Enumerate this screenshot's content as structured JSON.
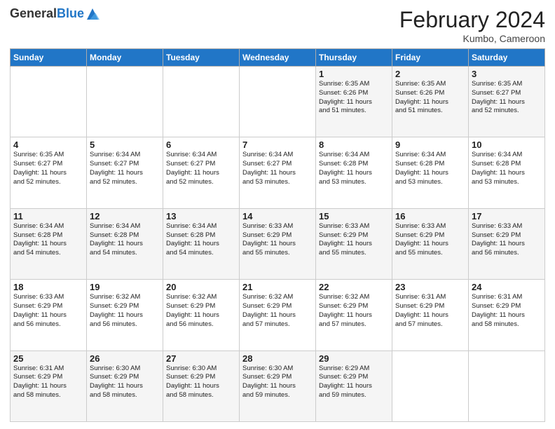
{
  "header": {
    "logo_general": "General",
    "logo_blue": "Blue",
    "month_title": "February 2024",
    "location": "Kumbo, Cameroon"
  },
  "weekdays": [
    "Sunday",
    "Monday",
    "Tuesday",
    "Wednesday",
    "Thursday",
    "Friday",
    "Saturday"
  ],
  "weeks": [
    [
      {
        "day": "",
        "info": ""
      },
      {
        "day": "",
        "info": ""
      },
      {
        "day": "",
        "info": ""
      },
      {
        "day": "",
        "info": ""
      },
      {
        "day": "1",
        "info": "Sunrise: 6:35 AM\nSunset: 6:26 PM\nDaylight: 11 hours\nand 51 minutes."
      },
      {
        "day": "2",
        "info": "Sunrise: 6:35 AM\nSunset: 6:26 PM\nDaylight: 11 hours\nand 51 minutes."
      },
      {
        "day": "3",
        "info": "Sunrise: 6:35 AM\nSunset: 6:27 PM\nDaylight: 11 hours\nand 52 minutes."
      }
    ],
    [
      {
        "day": "4",
        "info": "Sunrise: 6:35 AM\nSunset: 6:27 PM\nDaylight: 11 hours\nand 52 minutes."
      },
      {
        "day": "5",
        "info": "Sunrise: 6:34 AM\nSunset: 6:27 PM\nDaylight: 11 hours\nand 52 minutes."
      },
      {
        "day": "6",
        "info": "Sunrise: 6:34 AM\nSunset: 6:27 PM\nDaylight: 11 hours\nand 52 minutes."
      },
      {
        "day": "7",
        "info": "Sunrise: 6:34 AM\nSunset: 6:27 PM\nDaylight: 11 hours\nand 53 minutes."
      },
      {
        "day": "8",
        "info": "Sunrise: 6:34 AM\nSunset: 6:28 PM\nDaylight: 11 hours\nand 53 minutes."
      },
      {
        "day": "9",
        "info": "Sunrise: 6:34 AM\nSunset: 6:28 PM\nDaylight: 11 hours\nand 53 minutes."
      },
      {
        "day": "10",
        "info": "Sunrise: 6:34 AM\nSunset: 6:28 PM\nDaylight: 11 hours\nand 53 minutes."
      }
    ],
    [
      {
        "day": "11",
        "info": "Sunrise: 6:34 AM\nSunset: 6:28 PM\nDaylight: 11 hours\nand 54 minutes."
      },
      {
        "day": "12",
        "info": "Sunrise: 6:34 AM\nSunset: 6:28 PM\nDaylight: 11 hours\nand 54 minutes."
      },
      {
        "day": "13",
        "info": "Sunrise: 6:34 AM\nSunset: 6:28 PM\nDaylight: 11 hours\nand 54 minutes."
      },
      {
        "day": "14",
        "info": "Sunrise: 6:33 AM\nSunset: 6:29 PM\nDaylight: 11 hours\nand 55 minutes."
      },
      {
        "day": "15",
        "info": "Sunrise: 6:33 AM\nSunset: 6:29 PM\nDaylight: 11 hours\nand 55 minutes."
      },
      {
        "day": "16",
        "info": "Sunrise: 6:33 AM\nSunset: 6:29 PM\nDaylight: 11 hours\nand 55 minutes."
      },
      {
        "day": "17",
        "info": "Sunrise: 6:33 AM\nSunset: 6:29 PM\nDaylight: 11 hours\nand 56 minutes."
      }
    ],
    [
      {
        "day": "18",
        "info": "Sunrise: 6:33 AM\nSunset: 6:29 PM\nDaylight: 11 hours\nand 56 minutes."
      },
      {
        "day": "19",
        "info": "Sunrise: 6:32 AM\nSunset: 6:29 PM\nDaylight: 11 hours\nand 56 minutes."
      },
      {
        "day": "20",
        "info": "Sunrise: 6:32 AM\nSunset: 6:29 PM\nDaylight: 11 hours\nand 56 minutes."
      },
      {
        "day": "21",
        "info": "Sunrise: 6:32 AM\nSunset: 6:29 PM\nDaylight: 11 hours\nand 57 minutes."
      },
      {
        "day": "22",
        "info": "Sunrise: 6:32 AM\nSunset: 6:29 PM\nDaylight: 11 hours\nand 57 minutes."
      },
      {
        "day": "23",
        "info": "Sunrise: 6:31 AM\nSunset: 6:29 PM\nDaylight: 11 hours\nand 57 minutes."
      },
      {
        "day": "24",
        "info": "Sunrise: 6:31 AM\nSunset: 6:29 PM\nDaylight: 11 hours\nand 58 minutes."
      }
    ],
    [
      {
        "day": "25",
        "info": "Sunrise: 6:31 AM\nSunset: 6:29 PM\nDaylight: 11 hours\nand 58 minutes."
      },
      {
        "day": "26",
        "info": "Sunrise: 6:30 AM\nSunset: 6:29 PM\nDaylight: 11 hours\nand 58 minutes."
      },
      {
        "day": "27",
        "info": "Sunrise: 6:30 AM\nSunset: 6:29 PM\nDaylight: 11 hours\nand 58 minutes."
      },
      {
        "day": "28",
        "info": "Sunrise: 6:30 AM\nSunset: 6:29 PM\nDaylight: 11 hours\nand 59 minutes."
      },
      {
        "day": "29",
        "info": "Sunrise: 6:29 AM\nSunset: 6:29 PM\nDaylight: 11 hours\nand 59 minutes."
      },
      {
        "day": "",
        "info": ""
      },
      {
        "day": "",
        "info": ""
      }
    ]
  ]
}
